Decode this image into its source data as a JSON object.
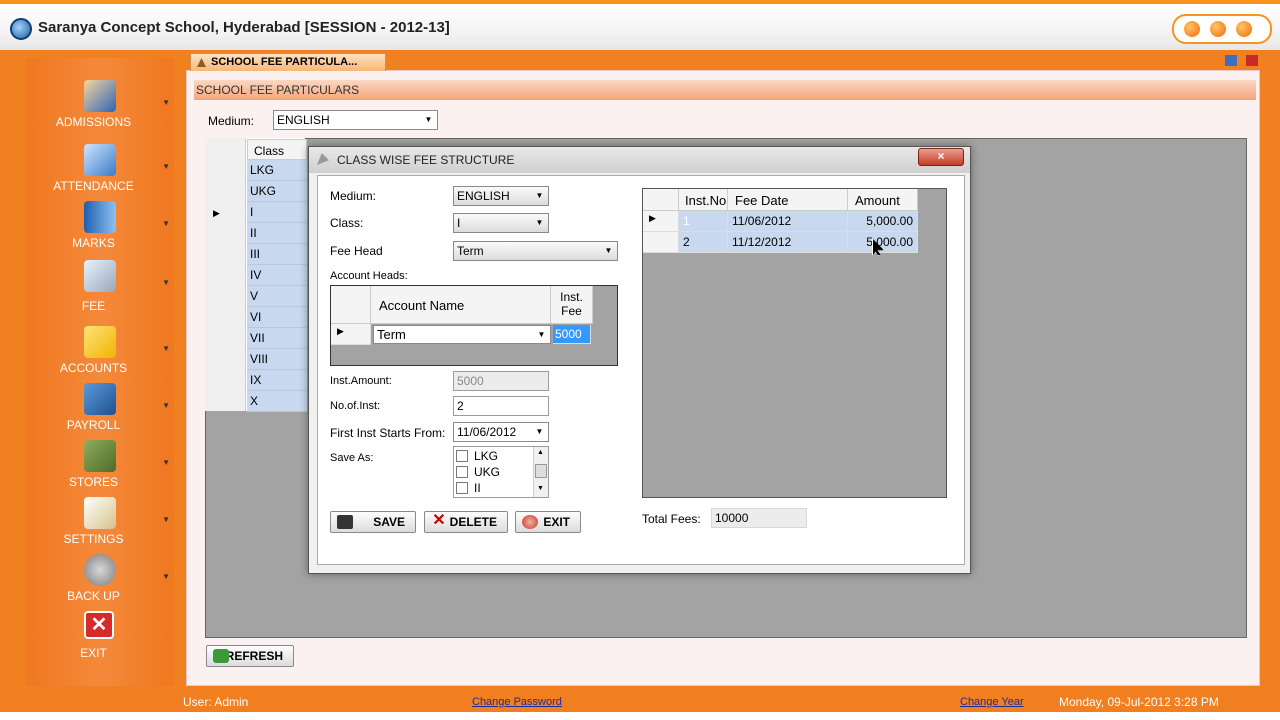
{
  "window": {
    "title": "Saranya Concept School, Hyderabad [SESSION - 2012-13]"
  },
  "sidebar": {
    "items": [
      {
        "label": "ADMISSIONS",
        "icon": "users-icon"
      },
      {
        "label": "ATTENDANCE",
        "icon": "calendar-check-icon"
      },
      {
        "label": "MARKS",
        "icon": "book-icon"
      },
      {
        "label": "FEE",
        "icon": "coins-icon"
      },
      {
        "label": "ACCOUNTS",
        "icon": "folder-icon"
      },
      {
        "label": "PAYROLL",
        "icon": "walking-man-icon"
      },
      {
        "label": "STORES",
        "icon": "cabinet-icon"
      },
      {
        "label": "SETTINGS",
        "icon": "settings-icon"
      },
      {
        "label": "BACK UP",
        "icon": "database-icon"
      },
      {
        "label": "EXIT",
        "icon": "close-icon"
      }
    ]
  },
  "tab": {
    "label": "SCHOOL FEE PARTICULA..."
  },
  "section": {
    "title": "SCHOOL FEE PARTICULARS"
  },
  "main": {
    "medium_label": "Medium:",
    "medium_value": "ENGLISH",
    "class_header": "Class",
    "classes": [
      "LKG",
      "UKG",
      "I",
      "II",
      "III",
      "IV",
      "V",
      "VI",
      "VII",
      "VIII",
      "IX",
      "X"
    ],
    "refresh_label": "REFRESH"
  },
  "dialog": {
    "title": "CLASS WISE FEE STRUCTURE",
    "close_symbol": "×",
    "medium_label": "Medium:",
    "medium_value": "ENGLISH",
    "class_label": "Class:",
    "class_value": "I",
    "fee_head_label": "Fee Head",
    "fee_head_value": "Term",
    "account_heads_label": "Account Heads:",
    "account_grid": {
      "col_name": "Account Name",
      "col_fee_line1": "Inst.",
      "col_fee_line2": "Fee",
      "row_name": "Term",
      "row_fee": "5000"
    },
    "inst_amount_label": "Inst.Amount:",
    "inst_amount_value": "5000",
    "no_of_inst_label": "No.of.Inst:",
    "no_of_inst_value": "2",
    "first_inst_label": "First Inst Starts From:",
    "first_inst_value": "11/06/2012",
    "save_as_label": "Save As:",
    "save_as_options": [
      "LKG",
      "UKG",
      "II"
    ],
    "fee_grid": {
      "headers": [
        "Inst.No",
        "Fee Date",
        "Amount"
      ],
      "rows": [
        {
          "no": "1",
          "date": "11/06/2012",
          "amount": "5,000.00"
        },
        {
          "no": "2",
          "date": "11/12/2012",
          "amount": "5,000.00"
        }
      ]
    },
    "total_fees_label": "Total Fees:",
    "total_fees_value": "10000",
    "buttons": {
      "save": "SAVE",
      "delete": "DELETE",
      "exit": "EXIT"
    }
  },
  "statusbar": {
    "user": "User: Admin",
    "change_password": "Change Password",
    "change_year": "Change Year",
    "datetime": "Monday, 09-Jul-2012 3:28 PM"
  },
  "colors": {
    "accent": "#f07820",
    "selection": "#3399ff",
    "grid_bg": "#a3a3a3"
  }
}
